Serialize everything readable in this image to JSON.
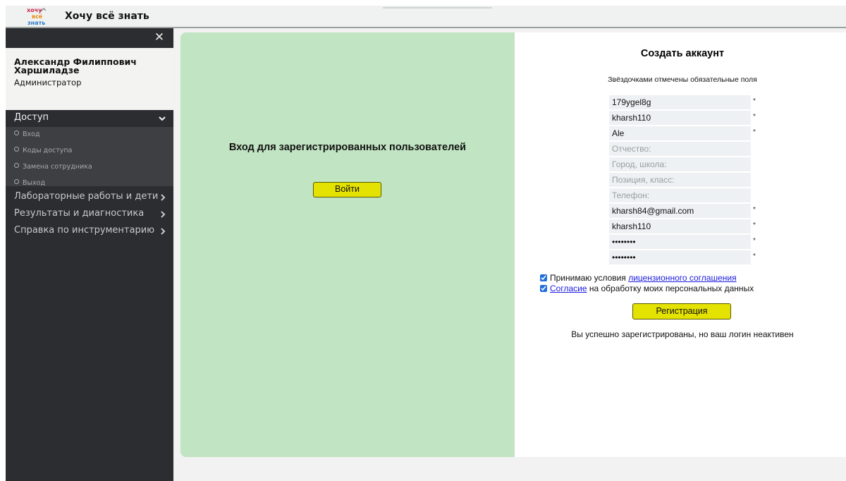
{
  "app": {
    "title": "Хочу всё знать",
    "logo_text": "Хочу всё знать",
    "close_symbol": "✕"
  },
  "user": {
    "name": "Александр Филиппович Харшиладзе",
    "role": "Администратор"
  },
  "sidebar": {
    "open_section": {
      "label": "Доступ",
      "items": [
        {
          "label": "Вход"
        },
        {
          "label": "Коды доступа"
        },
        {
          "label": "Замена сотрудника"
        },
        {
          "label": "Выход"
        }
      ]
    },
    "sections": [
      {
        "label": "Лабораторные работы и дети"
      },
      {
        "label": "Результаты и диагностика"
      },
      {
        "label": "Справка по инструментарию"
      }
    ]
  },
  "login": {
    "title": "Вход для зарегистрированных пользователей",
    "button": "Войти"
  },
  "register": {
    "title": "Создать аккаунт",
    "note": "Звёздочками отмечены обязательные поля",
    "required_mark": "*",
    "fields": [
      {
        "value": "179ygel8g",
        "placeholder": "",
        "required": true
      },
      {
        "value": "kharsh110",
        "placeholder": "",
        "required": true
      },
      {
        "value": "Ale",
        "placeholder": "",
        "required": true
      },
      {
        "value": "",
        "placeholder": "Отчество:",
        "required": false
      },
      {
        "value": "",
        "placeholder": "Город, школа:",
        "required": false
      },
      {
        "value": "",
        "placeholder": "Позиция, класс:",
        "required": false
      },
      {
        "value": "",
        "placeholder": "Телефон:",
        "required": false
      },
      {
        "value": "kharsh84@gmail.com",
        "placeholder": "",
        "required": true
      },
      {
        "value": "kharsh110",
        "placeholder": "",
        "required": true
      },
      {
        "value": "••••••••",
        "placeholder": "",
        "required": true
      },
      {
        "value": "••••••••",
        "placeholder": "",
        "required": true
      }
    ],
    "license": {
      "prefix": "Принимаю условия ",
      "link": "лицензионного соглашения",
      "checked": true
    },
    "consent": {
      "link": "Согласие",
      "suffix": " на обработку моих персональных данных",
      "checked": true
    },
    "button": "Регистрация",
    "status": "Вы успешно зарегистрированы, но ваш логин неактивен"
  },
  "colors": {
    "sidebar_bg": "#2c2d31",
    "submenu_bg": "#3d3f43",
    "login_panel_bg": "#c1e4c2",
    "button_yellow": "#e4e200",
    "link_blue": "#1a1ae0"
  }
}
